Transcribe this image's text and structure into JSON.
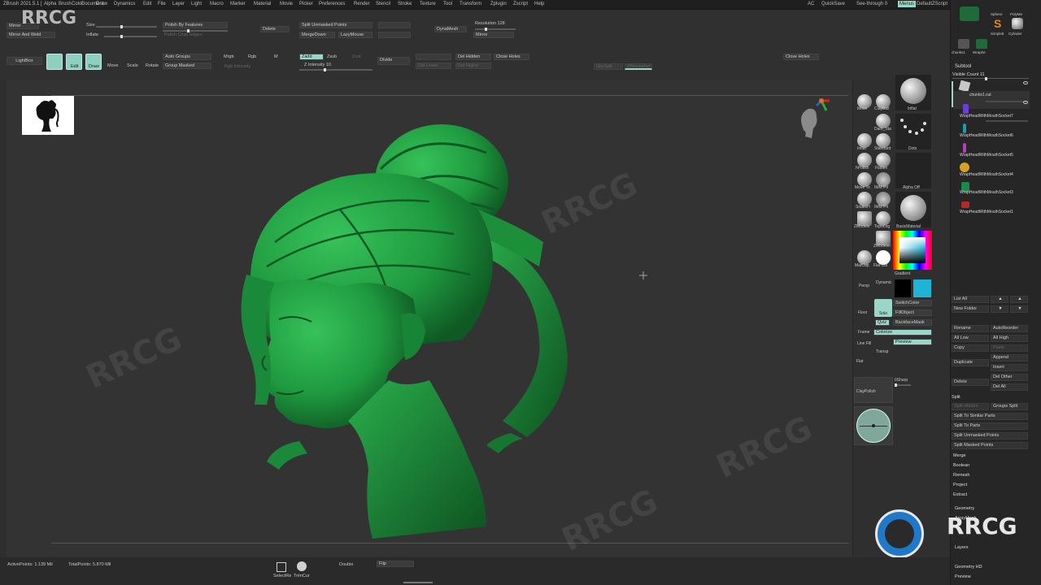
{
  "app": {
    "title": "ZBrush 2021.5.1 [",
    "brand_watermark": "RRCG"
  },
  "menu": {
    "items": [
      "Alpha",
      "Brush",
      "Color",
      "Document",
      "Draw",
      "Dynamics",
      "Edit",
      "File",
      "Layer",
      "Light",
      "Macro",
      "Marker",
      "Material",
      "Movie",
      "Picker",
      "Preferences",
      "Render",
      "Stencil",
      "Stroke",
      "Texture",
      "Tool",
      "Transform",
      "Zplugin",
      "Zscript",
      "Help"
    ],
    "ac": "AC",
    "quicksave": "QuickSave",
    "seethrough": "See-through  0",
    "menus": "Menus",
    "defaultzscript": "DefaultZScript"
  },
  "shelf": {
    "mirror": "Mirror",
    "mirror_weld": "Mirror And Weld",
    "size": "Size",
    "inflate": "Inflate",
    "polish_features": "Polish By Features",
    "polish_crisp": "Polish Crisp Edges",
    "delete": "Delete",
    "split_unmasked": "Split Unmasked Points",
    "merge_down": "MergeDown",
    "lazy_mouse": "LazyMouse",
    "dynamesh": "DynaMesh",
    "resolution": "Resolution 128",
    "mirror2": "Mirror",
    "lightbox": "LightBox",
    "edit": "Edit",
    "draw": "Draw",
    "move": "Move",
    "scale": "Scale",
    "rotate": "Rotate",
    "auto_groups": "Auto Groups",
    "group_masked": "Group Masked",
    "mrgb": "Mrgb",
    "rgb": "Rgb",
    "m": "M",
    "zadd": "Zadd",
    "zsub": "Zsub",
    "zcut": "Zcut",
    "z_intensity": "Z Intensity 10",
    "rgb_intensity": "Rgb Intensity",
    "divide": "Divide",
    "del_hidden": "Del Hidden",
    "close_holes": "Close Holes",
    "del_higher": "Del Higher",
    "del_lower": "Del Lower",
    "close_holes2": "Close Holes",
    "groups_split": "GrpSplit",
    "zremesher": "ZRemesher"
  },
  "tray": {
    "brushes": [
      "Move",
      "ClayBuil",
      "Standard",
      "Inflat",
      "Dam_Sta",
      "hPolish",
      "Flatten",
      "Move To",
      "IMM Pri",
      "SnakeH",
      "IMM Pri",
      "ZModele",
      "TopoLog",
      "MatCap",
      "Flat Col"
    ],
    "labels": {
      "inflate": "Inflat",
      "dots": "Dots",
      "alpha_off": "Alpha Off",
      "basic_material": "BasicMaterial",
      "zmodeler": "ZModeler",
      "gradient": "Gradient",
      "switch_color": "SwitchColor",
      "fill_object": "FillObject",
      "qviz": "Qviz",
      "backface_mask": "BackfaceMask",
      "colorize": "Colorize",
      "preview": "Preview",
      "floor": "Floor",
      "frame": "Frame",
      "flat": "Flat",
      "ssharp": "0Sharp",
      "claypolish": "ClayPolish",
      "persp": "Persp",
      "dynamic": "Dynamic",
      "solo": "Solo",
      "line_fill": "Line Fill",
      "transp": "Transp"
    }
  },
  "subtool": {
    "header": "Subtool",
    "visible_count": "Visible Count 11",
    "items": [
      {
        "name": "chunks1.cut",
        "color": "#c7c7c7"
      },
      {
        "name": "WrapHeadWithMouthSocket7",
        "color": "#6b3fd6"
      },
      {
        "name": "WrapHeadWithMouthSocket6",
        "color": "#1f9aa8"
      },
      {
        "name": "WrapHeadWithMouthSocket5",
        "color": "#b63fb6"
      },
      {
        "name": "WrapHeadWithMouthSocket4",
        "color": "#d8a020"
      },
      {
        "name": "WrapHeadWithMouthSocket3",
        "color": "#1a8a4a"
      },
      {
        "name": "WrapHeadWithMouthSocket1",
        "color": "#b42a2a"
      }
    ],
    "top_items": [
      "Sphere",
      "PolyMe",
      "Simple8",
      "Cylinder",
      "chunks1",
      "Wraphe"
    ],
    "list_all": "List All",
    "new_folder": "New Folder",
    "rename": "Rename",
    "auto_reorder": "AutoReorder",
    "all_low": "All Low",
    "all_high": "All High",
    "copy": "Copy",
    "paste": "Paste",
    "append": "Append",
    "duplicate": "Duplicate",
    "insert": "Insert",
    "delete": "Delete",
    "del_other": "Del Other",
    "del_all": "Del All",
    "split": "Split",
    "split_hidden": "Split Hidden",
    "groups_split": "Groups Split",
    "split_similar": "Split To Similar Parts",
    "split_parts": "Split To Parts",
    "split_unmasked": "Split Unmasked Points",
    "split_masked": "Split Masked Points",
    "merge": "Merge",
    "boolean": "Boolean",
    "remesh": "Remesh",
    "project": "Project",
    "extract": "Extract",
    "geometry": "Geometry",
    "arraymesh": "ArrayMesh",
    "layers": "Layers",
    "geometry_hd": "Geometry HD",
    "preview": "Preview"
  },
  "status": {
    "active_points": "ActivePoints: 1.139 Mil",
    "total_points": "TotalPoints: 5.870 Mil",
    "select_rect": "SelectRe",
    "trim_curve": "TrimCur",
    "double": "Double",
    "flip": "Flip"
  },
  "colors": {
    "model_green": "#1f9a3f",
    "accent_teal": "#9ad7c8",
    "secondary_cyan": "#1fb3d6"
  }
}
